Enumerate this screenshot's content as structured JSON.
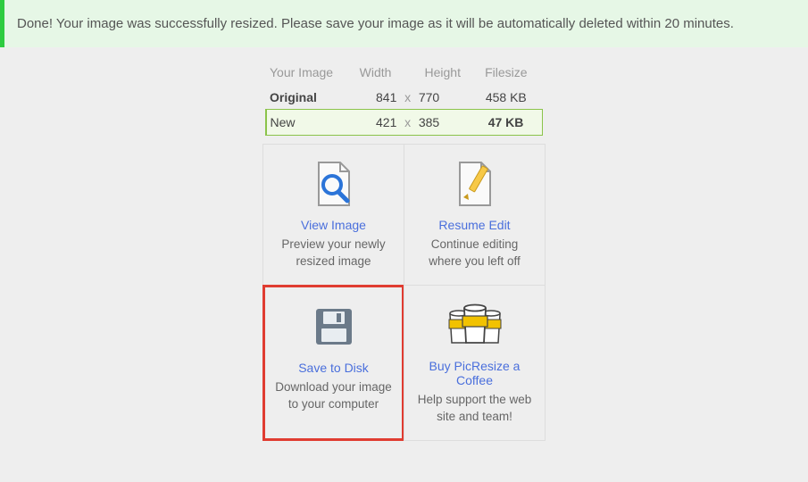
{
  "notice": "Done! Your image was successfully resized. Please save your image as it will be automatically deleted within 20 minutes.",
  "stats": {
    "headers": {
      "image": "Your Image",
      "width": "Width",
      "height": "Height",
      "filesize": "Filesize"
    },
    "original": {
      "label": "Original",
      "width": "841",
      "height": "770",
      "filesize": "458 KB"
    },
    "new": {
      "label": "New",
      "width": "421",
      "height": "385",
      "filesize": "47 KB"
    },
    "x": "x"
  },
  "cards": {
    "view": {
      "title": "View Image",
      "desc": "Preview your newly resized image"
    },
    "resume": {
      "title": "Resume Edit",
      "desc": "Continue editing where you left off"
    },
    "save": {
      "title": "Save to Disk",
      "desc": "Download your image to your computer"
    },
    "coffee": {
      "title": "Buy PicResize a Coffee",
      "desc": "Help support the web site and team!"
    }
  }
}
